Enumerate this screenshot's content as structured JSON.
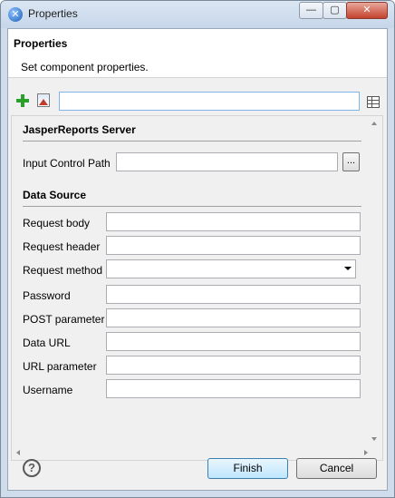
{
  "window": {
    "title": "Properties",
    "controls": {
      "minimize": "—",
      "maximize": "▢",
      "close": "✕"
    }
  },
  "header": {
    "title": "Properties",
    "subtitle": "Set component properties."
  },
  "toolbar": {
    "add_icon": "plus-icon",
    "image_icon": "image-icon",
    "search_value": "",
    "table_icon": "table-icon"
  },
  "sections": {
    "server": {
      "title": "JasperReports Server",
      "input_control_path_label": "Input Control Path",
      "input_control_path_value": "",
      "browse_label": "..."
    },
    "data_source": {
      "title": "Data Source",
      "fields": [
        {
          "label": "Request body",
          "value": ""
        },
        {
          "label": "Request header",
          "value": ""
        },
        {
          "label": "Request method",
          "value": ""
        },
        {
          "label": "Password",
          "value": ""
        },
        {
          "label": "POST parameter",
          "value": ""
        },
        {
          "label": "Data URL",
          "value": ""
        },
        {
          "label": "URL parameter",
          "value": ""
        },
        {
          "label": "Username",
          "value": ""
        }
      ]
    }
  },
  "footer": {
    "help": "?",
    "finish_label": "Finish",
    "cancel_label": "Cancel"
  }
}
